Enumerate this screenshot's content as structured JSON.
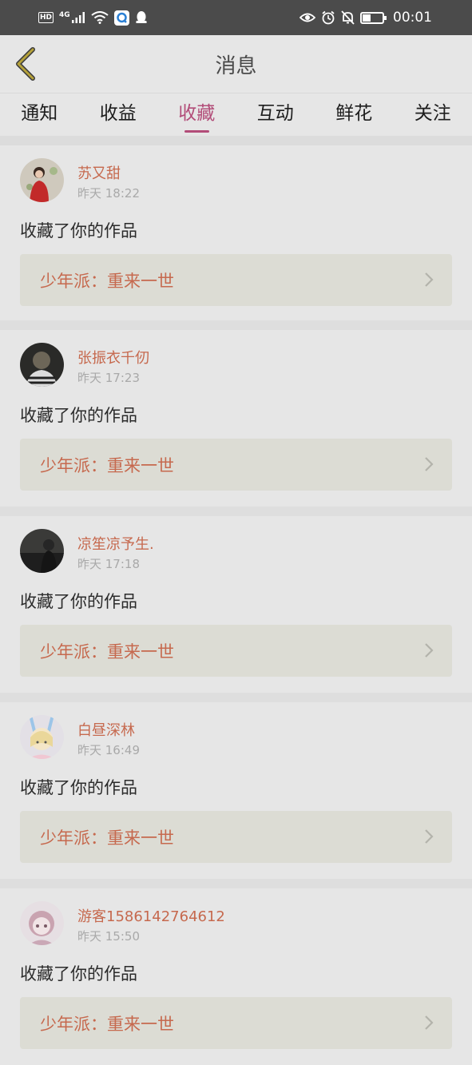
{
  "status_bar": {
    "left_icons": [
      "hd-icon",
      "signal-4g-icon",
      "wifi-icon",
      "app-q-icon",
      "qq-penguin-icon"
    ],
    "network_label": "4G",
    "hd_label": "HD",
    "right_icons": [
      "eye-icon",
      "alarm-icon",
      "bell-off-icon",
      "battery-icon"
    ],
    "battery_level": 0.4,
    "time": "00:01"
  },
  "header": {
    "title": "消息",
    "back_icon": "chevron-left-icon"
  },
  "tabs": [
    {
      "label": "通知",
      "active": false
    },
    {
      "label": "收益",
      "active": false
    },
    {
      "label": "收藏",
      "active": true
    },
    {
      "label": "互动",
      "active": false
    },
    {
      "label": "鲜花",
      "active": false
    },
    {
      "label": "关注",
      "active": false
    }
  ],
  "colors": {
    "accent": "#b24c78",
    "username": "#c6694e",
    "background": "#e6e6e6"
  },
  "items": [
    {
      "username": "苏又甜",
      "time": "昨天 18:22",
      "action": "收藏了你的作品",
      "work_title": "少年派：重来一世"
    },
    {
      "username": "张振衣千仞",
      "time": "昨天 17:23",
      "action": "收藏了你的作品",
      "work_title": "少年派：重来一世"
    },
    {
      "username": "凉笙凉予生.",
      "time": "昨天 17:18",
      "action": "收藏了你的作品",
      "work_title": "少年派：重来一世"
    },
    {
      "username": "白昼深林",
      "time": "昨天 16:49",
      "action": "收藏了你的作品",
      "work_title": "少年派：重来一世"
    },
    {
      "username": "游客1586142764612",
      "time": "昨天 15:50",
      "action": "收藏了你的作品",
      "work_title": "少年派：重来一世"
    }
  ]
}
